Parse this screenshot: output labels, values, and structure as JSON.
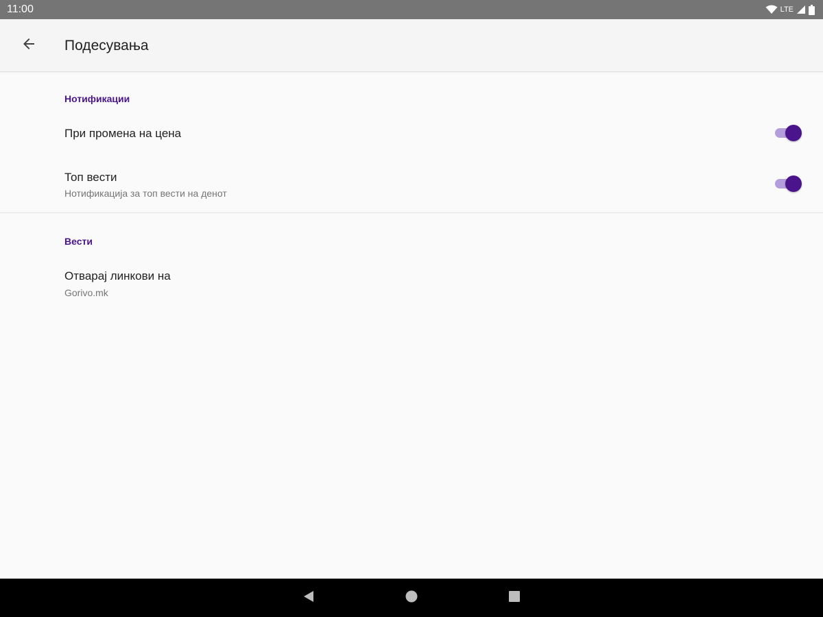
{
  "status_bar": {
    "time": "11:00",
    "network": "LTE",
    "icons": [
      "wifi-icon",
      "signal-icon",
      "battery-icon"
    ]
  },
  "app_bar": {
    "title": "Подесувања",
    "back_icon": "arrow-back-icon"
  },
  "sections": {
    "notifications": {
      "header": "Нотификации",
      "price_change": {
        "title": "При промена на цена",
        "enabled": true
      },
      "top_news": {
        "title": "Топ вести",
        "summary": "Нотификација за топ вести на денот",
        "enabled": true
      }
    },
    "news": {
      "header": "Вести",
      "open_links": {
        "title": "Отварај линкови на",
        "summary": "Gorivo.mk"
      }
    }
  },
  "nav_bar": {
    "icons": [
      "back-triangle-icon",
      "home-circle-icon",
      "recents-square-icon"
    ]
  },
  "colors": {
    "accent": "#4a148c",
    "accent_track": "#b39ddb",
    "status_bar": "#757575",
    "app_bar": "#f5f5f5",
    "background": "#fafafa",
    "nav_bar": "#000000"
  }
}
